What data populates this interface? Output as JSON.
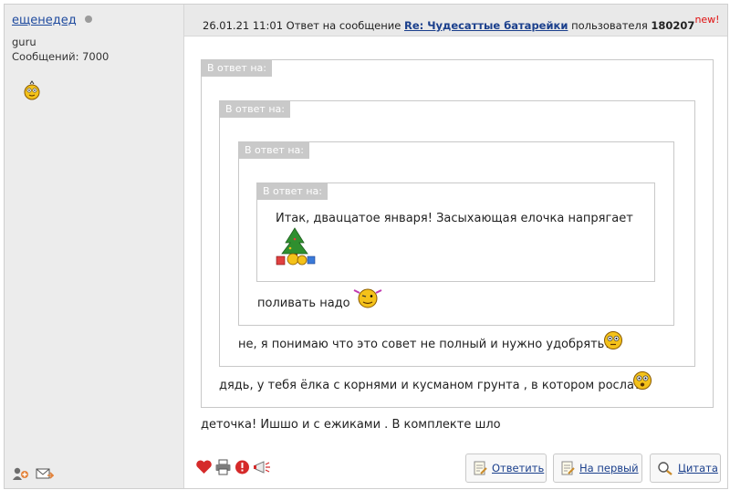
{
  "user": {
    "name": "ещенедед",
    "rank": "guru",
    "messages": "Сообщений: 7000"
  },
  "header": {
    "datetime": "26.01.21 11:01",
    "reply_to_text": "Ответ на сообщение",
    "thread_link": "Re: Чудесаттые батарейки",
    "by_user_text": "пользователя",
    "author_id": "180207",
    "new_badge": "new!"
  },
  "quotes": {
    "label": "В ответ на:",
    "level4_text": "Итак, дваuцатое января! Засыхающая елочка напрягает",
    "level3_text": "поливать надо",
    "level2_text": "не, я понимаю что это совет не полный и нужно удобрять?",
    "level1_text": "дядь, у тебя ёлка с корнями и кусманом грунта , в котором росла?"
  },
  "message": "деточка! Ишшо и с ежиками . В комплекте шло",
  "buttons": {
    "reply": "Ответить",
    "to_first": "На первый",
    "quote": "Цитата"
  },
  "colors": {
    "link": "#1a3f8c",
    "new_badge": "#e01010",
    "quote_label_bg": "#c9c9c9"
  }
}
